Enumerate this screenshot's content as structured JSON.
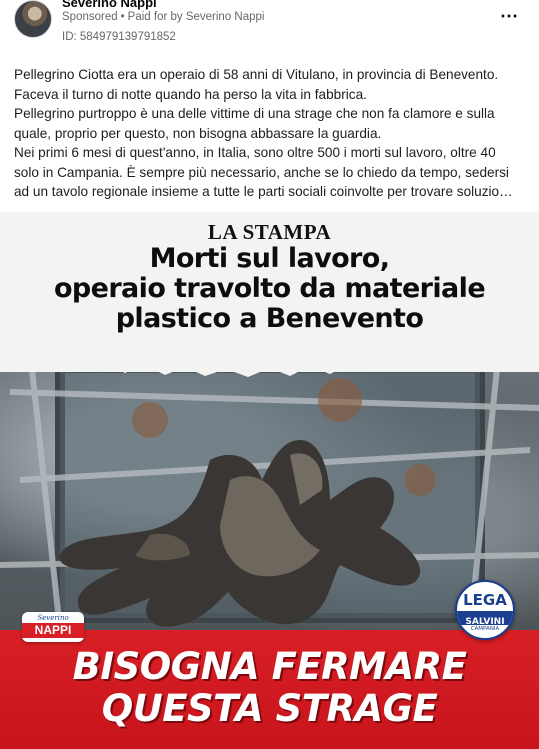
{
  "post": {
    "author": "Severino Nappi",
    "sponsored_label": "Sponsored",
    "separator": "•",
    "paid_for_label": "Paid for by Severino Nappi",
    "ad_id": "ID: 584979139791852",
    "more_icon": "more-horizontal-icon",
    "more_label": "⋯"
  },
  "body_text": [
    "Pellegrino Ciotta era un operaio di 58 anni di Vitulano, in provincia di Benevento.",
    "Faceva il turno di notte quando ha perso la vita in fabbrica.",
    "Pellegrino purtroppo è una delle vittime di una strage che non fa clamore e sulla",
    "quale, proprio per questo, non bisogna abbassare la guardia.",
    "Nei primi 6 mesi di quest'anno, in Italia, sono oltre 500 i morti sul lavoro, oltre 40",
    "solo in Campania. È sempre più necessario, anche se lo chiedo da tempo, sedersi",
    "ad un tavolo regionale insieme a tutte le parti sociali coinvolte per trovare soluzio…"
  ],
  "creative": {
    "masthead": "LA STAMPA",
    "headline": [
      "Morti sul lavoro,",
      "operaio travolto da materiale",
      "plastico a Benevento"
    ],
    "slogan": [
      "BISOGNA FERMARE",
      "QUESTA STRAGE"
    ],
    "nappi_logo": {
      "small": "Severino",
      "big": "NAPPI"
    },
    "lega_logo": {
      "word": "LEGA",
      "band": "SALVINI",
      "region": "CAMPANIA"
    },
    "colors": {
      "banner_red": "#d81f26",
      "lega_blue": "#1b3f8f",
      "slogan_white": "#ffffff"
    }
  }
}
